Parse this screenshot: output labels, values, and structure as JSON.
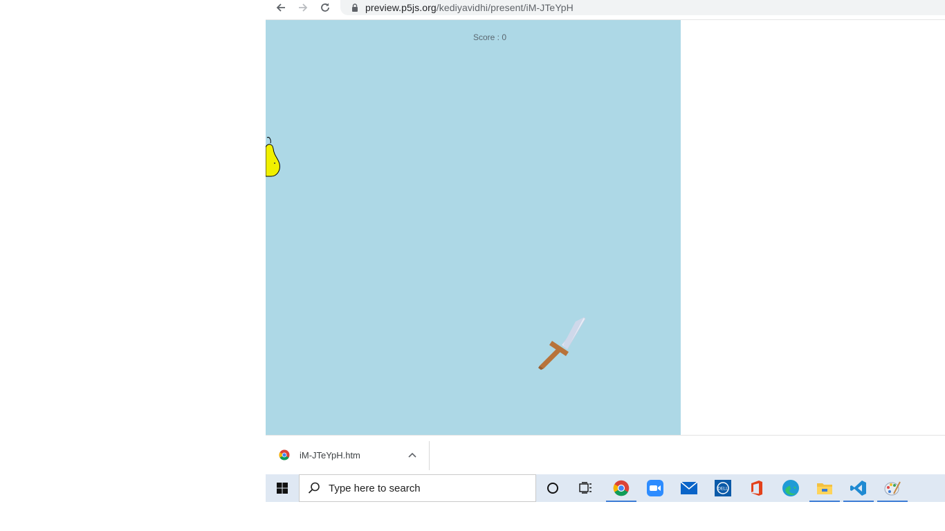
{
  "browser": {
    "url_host": "preview.p5js.org",
    "url_path": "/kediyavidhi/present/iM-JTeYpH"
  },
  "game": {
    "score_text": "Score : 0",
    "canvas_color": "#add8e6"
  },
  "download": {
    "filename": "iM-JTeYpH.htm"
  },
  "taskbar": {
    "search_placeholder": "Type here to search",
    "apps": [
      "cortana-icon",
      "task-view-icon",
      "chrome-icon",
      "zoom-icon",
      "mail-icon",
      "dell-icon",
      "office-icon",
      "edge-icon",
      "file-explorer-icon",
      "vscode-icon",
      "paint-icon"
    ]
  }
}
